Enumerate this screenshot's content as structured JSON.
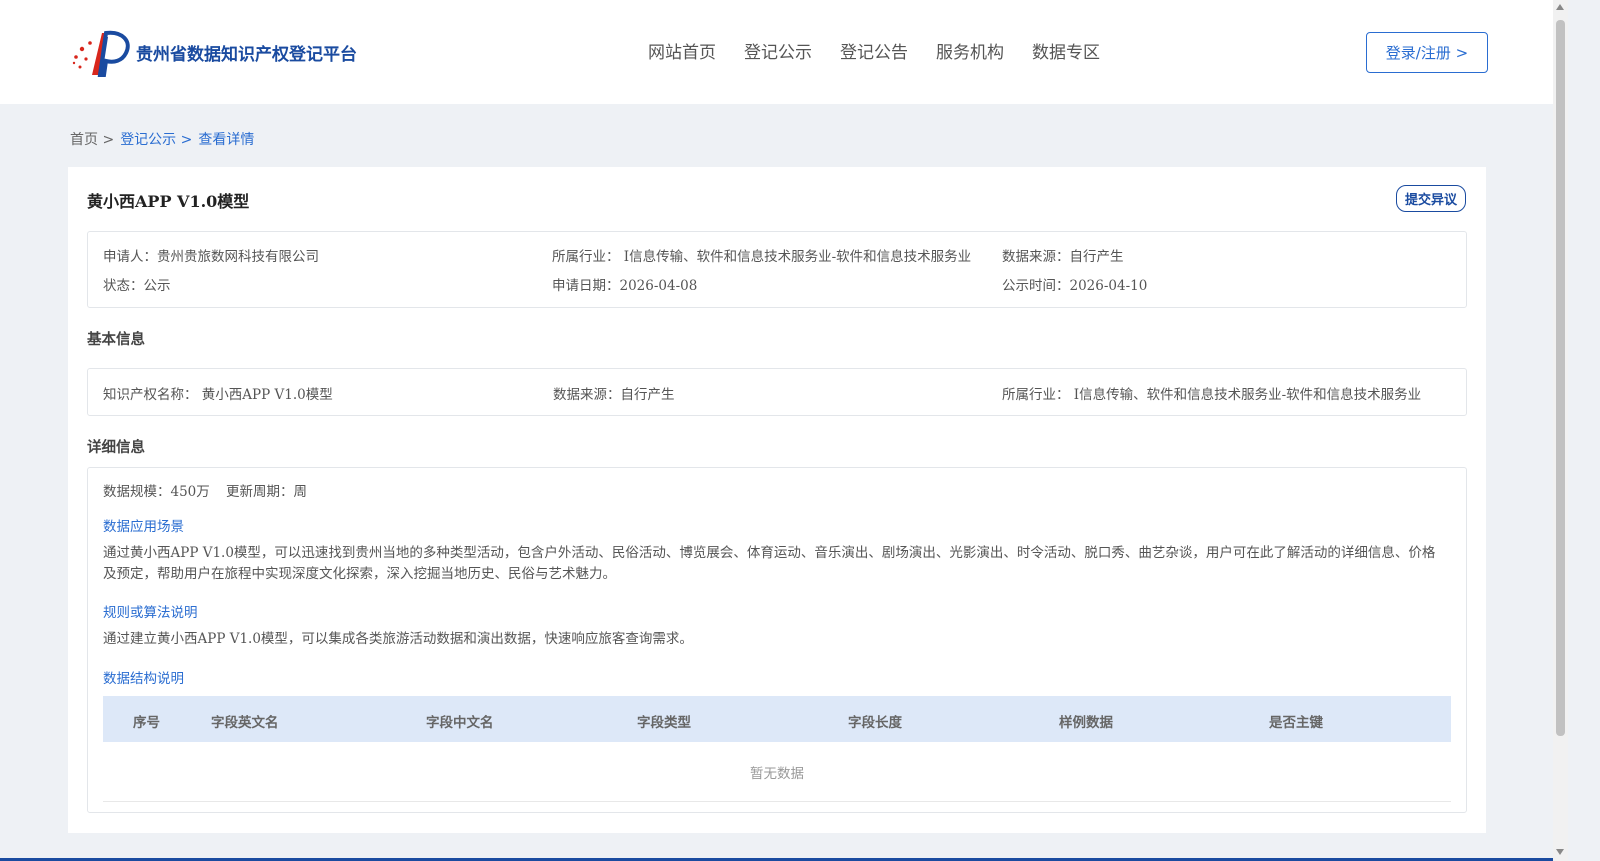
{
  "header": {
    "site_name": "贵州省数据知识产权登记平台",
    "nav": [
      "网站首页",
      "登记公示",
      "登记公告",
      "服务机构",
      "数据专区"
    ],
    "login_label": "登录/注册 >"
  },
  "breadcrumb": {
    "home": "首页 >",
    "level1": "登记公示 >",
    "current": "查看详情"
  },
  "detail": {
    "title": "黄小西APP V1.0模型",
    "objection_label": "提交异议",
    "applicant": "申请人：贵州贵旅数网科技有限公司",
    "industry": "所属行业： I信息传输、软件和信息技术服务业-软件和信息技术服务业",
    "data_source": "数据来源：自行产生",
    "status": "状态：公示",
    "apply_date": "申请日期：2026-04-08",
    "publish_date": "公示时间：2026-04-10"
  },
  "basic_info": {
    "section_title": "基本信息",
    "ip_name": "知识产权名称： 黄小西APP V1.0模型",
    "data_source": "数据来源：自行产生",
    "industry": "所属行业： I信息传输、软件和信息技术服务业-软件和信息技术服务业"
  },
  "detail_info": {
    "section_title": "详细信息",
    "scale": "数据规模：450万",
    "update_cycle": "更新周期：周",
    "scenario_title": "数据应用场景",
    "scenario_text_line1": "通过黄小西APP V1.0模型，可以迅速找到贵州当地的多种类型活动，包含户外活动、民俗活动、博览展会、体育运动、音乐演出、剧场演出、光影演出、时令活动、脱口秀、曲艺杂谈，用户可在此了解活动的详细信息、价格",
    "scenario_text_line2": "及预定，帮助用户在旅程中实现深度文化探索，深入挖掘当地历史、民俗与艺术魅力。",
    "algorithm_title": "规则或算法说明",
    "algorithm_text": "通过建立黄小西APP V1.0模型，可以集成各类旅游活动数据和演出数据，快速响应旅客查询需求。",
    "structure_title": "数据结构说明",
    "table_headers": [
      "序号",
      "字段英文名",
      "字段中文名",
      "字段类型",
      "字段长度",
      "样例数据",
      "是否主键"
    ],
    "empty_text": "暂无数据"
  }
}
